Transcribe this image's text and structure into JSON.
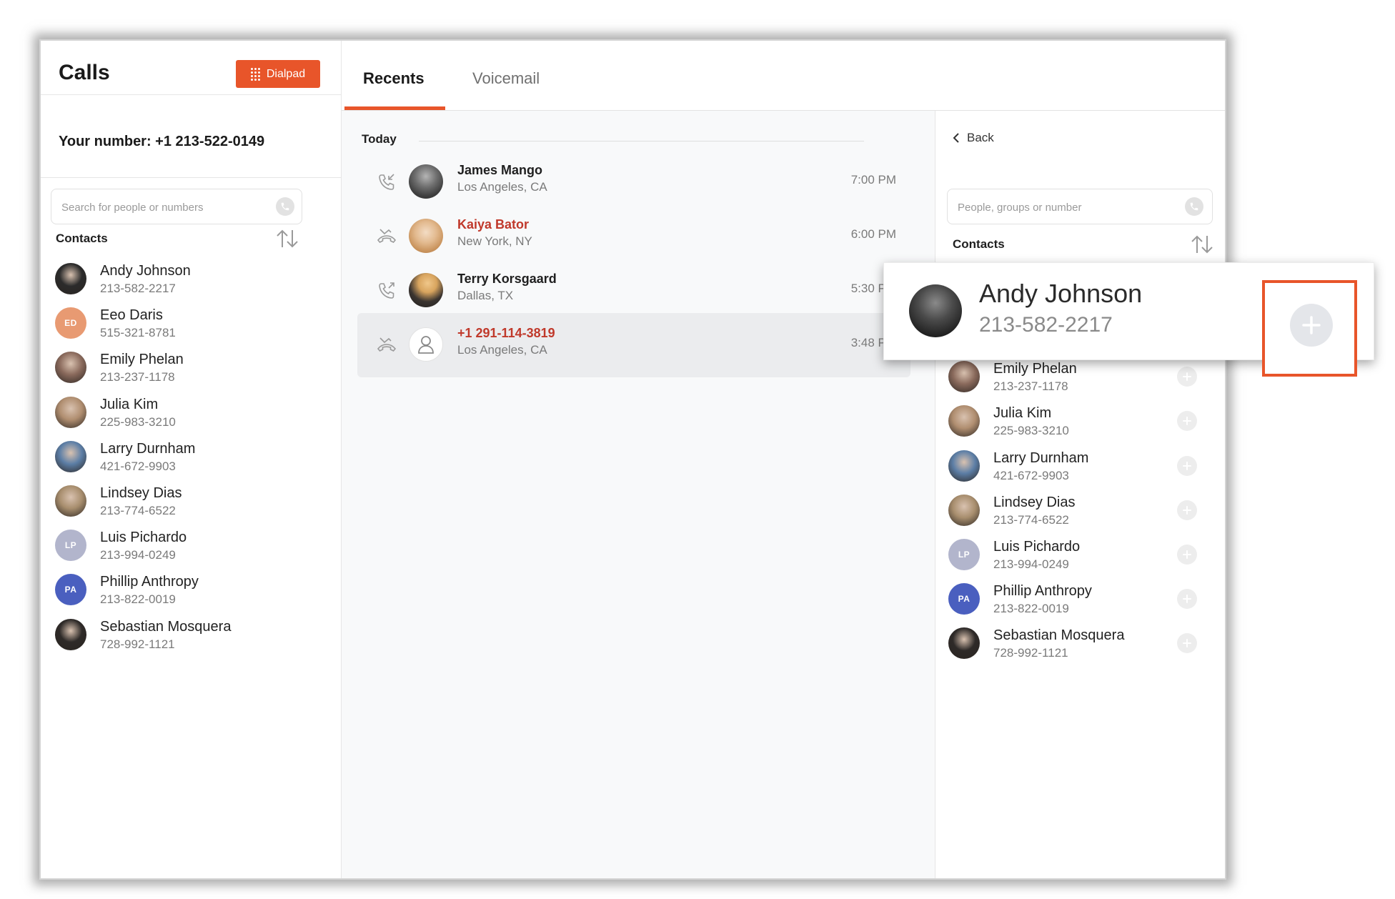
{
  "sidebar": {
    "title": "Calls",
    "dialpad_label": "Dialpad",
    "your_number": "Your number: +1 213-522-0149",
    "search_placeholder": "Search for people or numbers",
    "contacts_title": "Contacts",
    "contacts": [
      {
        "name": "Andy Johnson",
        "phone": "213-582-2217",
        "initials": "",
        "color": "#2b2b2b"
      },
      {
        "name": "Eeo Daris",
        "phone": "515-321-8781",
        "initials": "ED",
        "color": "#e89a72"
      },
      {
        "name": "Emily Phelan",
        "phone": "213-237-1178",
        "initials": "",
        "color": "#8a6a5c"
      },
      {
        "name": "Julia Kim",
        "phone": "225-983-3210",
        "initials": "",
        "color": "#b08e70"
      },
      {
        "name": "Larry Durnham",
        "phone": "421-672-9903",
        "initials": "",
        "color": "#5c7ea6"
      },
      {
        "name": "Lindsey Dias",
        "phone": "213-774-6522",
        "initials": "",
        "color": "#a88e6e"
      },
      {
        "name": "Luis Pichardo",
        "phone": "213-994-0249",
        "initials": "LP",
        "color": "#b2b5cc"
      },
      {
        "name": "Phillip Anthropy",
        "phone": "213-822-0019",
        "initials": "PA",
        "color": "#4a5fbf"
      },
      {
        "name": "Sebastian Mosquera",
        "phone": "728-992-1121",
        "initials": "",
        "color": "#2e2a28"
      }
    ]
  },
  "tabs": {
    "recents": "Recents",
    "voicemail": "Voicemail"
  },
  "recents": {
    "today_label": "Today",
    "items": [
      {
        "name": "James Mango",
        "location": "Los Angeles, CA",
        "time": "7:00 PM",
        "type": "incoming",
        "missed": false
      },
      {
        "name": "Kaiya Bator",
        "location": "New York, NY",
        "time": "6:00 PM",
        "type": "missed",
        "missed": true
      },
      {
        "name": "Terry Korsgaard",
        "location": "Dallas, TX",
        "time": "5:30 PM",
        "type": "outgoing",
        "missed": false
      },
      {
        "name": "+1 291-114-3819",
        "location": "Los Angeles, CA",
        "time": "3:48 PM",
        "type": "missed",
        "missed": true
      }
    ]
  },
  "right_panel": {
    "back_label": "Back",
    "search_placeholder": "People, groups or number",
    "contacts_title": "Contacts"
  },
  "popup": {
    "name": "Andy Johnson",
    "phone": "213-582-2217"
  },
  "colors": {
    "accent": "#e8552a",
    "missed": "#c0392b"
  }
}
